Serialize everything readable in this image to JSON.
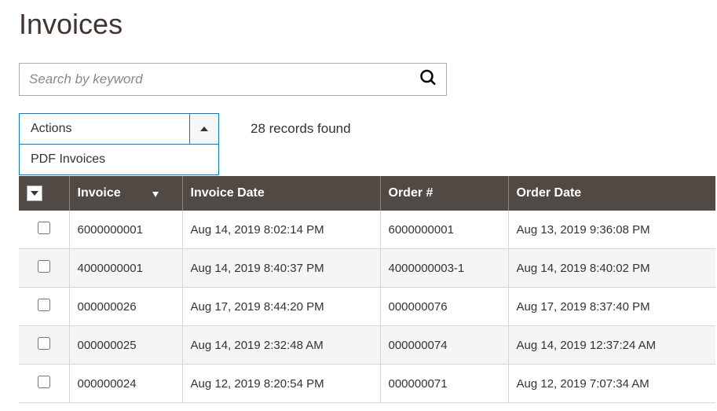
{
  "page_title": "Invoices",
  "search": {
    "placeholder": "Search by keyword"
  },
  "actions": {
    "label": "Actions",
    "open": true,
    "items": [
      "PDF Invoices"
    ]
  },
  "records_found": "28 records found",
  "table": {
    "headers": {
      "invoice": "Invoice",
      "invoice_date": "Invoice Date",
      "order": "Order #",
      "order_date": "Order Date"
    },
    "rows": [
      {
        "invoice": "6000000001",
        "invoice_date": "Aug 14, 2019 8:02:14 PM",
        "order": "6000000001",
        "order_date": "Aug 13, 2019 9:36:08 PM"
      },
      {
        "invoice": "4000000001",
        "invoice_date": "Aug 14, 2019 8:40:37 PM",
        "order": "4000000003-1",
        "order_date": "Aug 14, 2019 8:40:02 PM"
      },
      {
        "invoice": "000000026",
        "invoice_date": "Aug 17, 2019 8:44:20 PM",
        "order": "000000076",
        "order_date": "Aug 17, 2019 8:37:40 PM"
      },
      {
        "invoice": "000000025",
        "invoice_date": "Aug 14, 2019 2:32:48 AM",
        "order": "000000074",
        "order_date": "Aug 14, 2019 12:37:24 AM"
      },
      {
        "invoice": "000000024",
        "invoice_date": "Aug 12, 2019 8:20:54 PM",
        "order": "000000071",
        "order_date": "Aug 12, 2019 7:07:34 AM"
      }
    ]
  }
}
